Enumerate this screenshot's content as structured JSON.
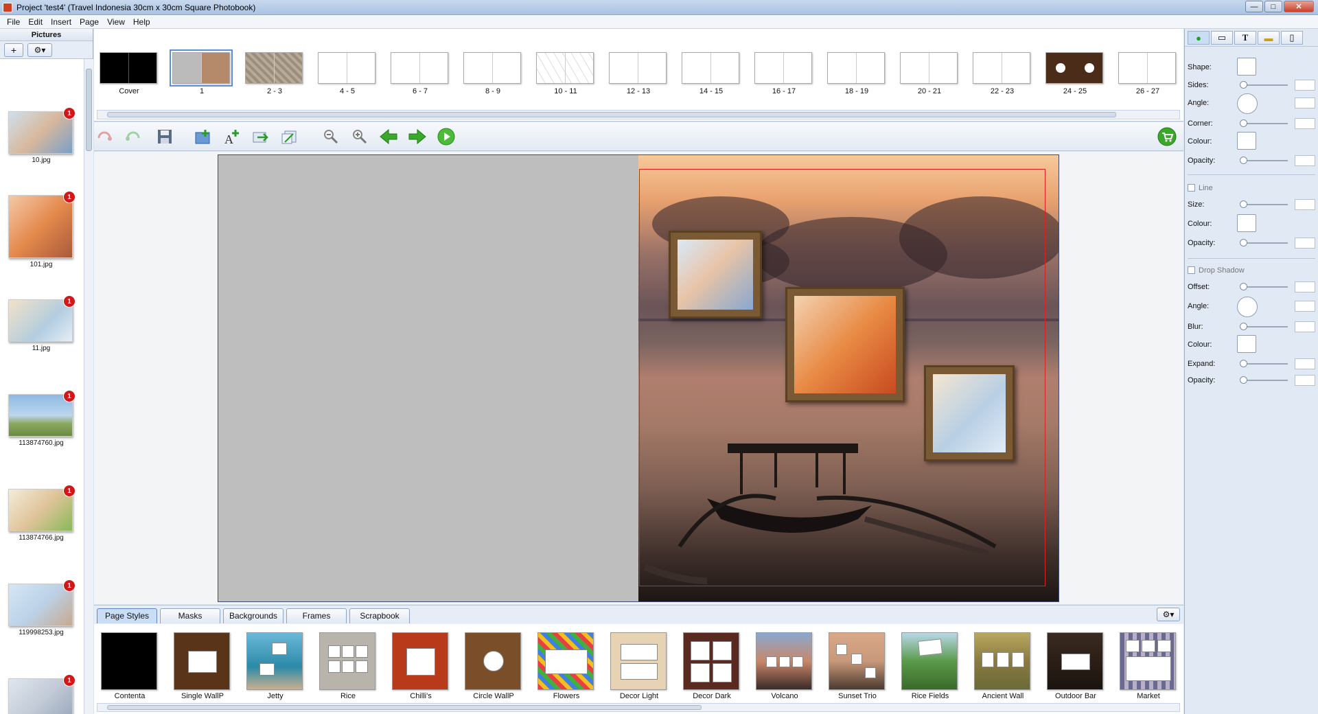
{
  "window": {
    "title": "Project 'test4' (Travel Indonesia 30cm x 30cm Square Photobook)",
    "min": "—",
    "max": "□",
    "close": "✕"
  },
  "menu": [
    "File",
    "Edit",
    "Insert",
    "Page",
    "View",
    "Help"
  ],
  "pictures": {
    "header": "Pictures",
    "add_label": "+",
    "settings_label": "⚙▾",
    "items": [
      {
        "name": "10.jpg",
        "badge": "1"
      },
      {
        "name": "101.jpg",
        "badge": "1"
      },
      {
        "name": "11.jpg",
        "badge": "1"
      },
      {
        "name": "113874760.jpg",
        "badge": "1"
      },
      {
        "name": "113874766.jpg",
        "badge": "1"
      },
      {
        "name": "119998253.jpg",
        "badge": "1"
      },
      {
        "name": "",
        "badge": "1"
      }
    ]
  },
  "pages": [
    {
      "label": "Cover"
    },
    {
      "label": "1"
    },
    {
      "label": "2 - 3"
    },
    {
      "label": "4 - 5"
    },
    {
      "label": "6 - 7"
    },
    {
      "label": "8 - 9"
    },
    {
      "label": "10 - 11"
    },
    {
      "label": "12 - 13"
    },
    {
      "label": "14 - 15"
    },
    {
      "label": "16 - 17"
    },
    {
      "label": "18 - 19"
    },
    {
      "label": "20 - 21"
    },
    {
      "label": "22 - 23"
    },
    {
      "label": "24 - 25"
    },
    {
      "label": "26 - 27"
    }
  ],
  "selected_page": "1",
  "toolbar": {
    "undo": "undo-icon",
    "redo": "redo-icon",
    "save": "save-icon",
    "add_page": "add-page-icon",
    "add_text": "add-text-icon",
    "export": "export-icon",
    "import": "import-icon",
    "zoom_out": "zoom-out-icon",
    "zoom_in": "zoom-in-icon",
    "prev": "arrow-left-icon",
    "next": "arrow-right-icon",
    "play": "play-icon",
    "cart": "cart-icon"
  },
  "bottom_tabs": [
    "Page Styles",
    "Masks",
    "Backgrounds",
    "Frames",
    "Scrapbook"
  ],
  "active_tab": "Page Styles",
  "page_styles": [
    "Contenta",
    "Single WallP",
    "Jetty",
    "Rice",
    "Chilli's",
    "Circle WallP",
    "Flowers",
    "Decor Light",
    "Decor Dark",
    "Volcano",
    "Sunset Trio",
    "Rice Fields",
    "Ancient Wall",
    "Outdoor Bar",
    "Market"
  ],
  "properties": {
    "shape": "Shape:",
    "sides": "Sides:",
    "angle": "Angle:",
    "corner": "Corner:",
    "colour": "Colour:",
    "opacity": "Opacity:",
    "line": "Line",
    "size": "Size:",
    "drop_shadow": "Drop Shadow",
    "offset": "Offset:",
    "blur": "Blur:",
    "expand": "Expand:"
  },
  "colors": {
    "accent": "#5b8ed8",
    "badge": "#d01818",
    "safe_area": "#e02020",
    "green_arrow": "#3aa82a"
  }
}
